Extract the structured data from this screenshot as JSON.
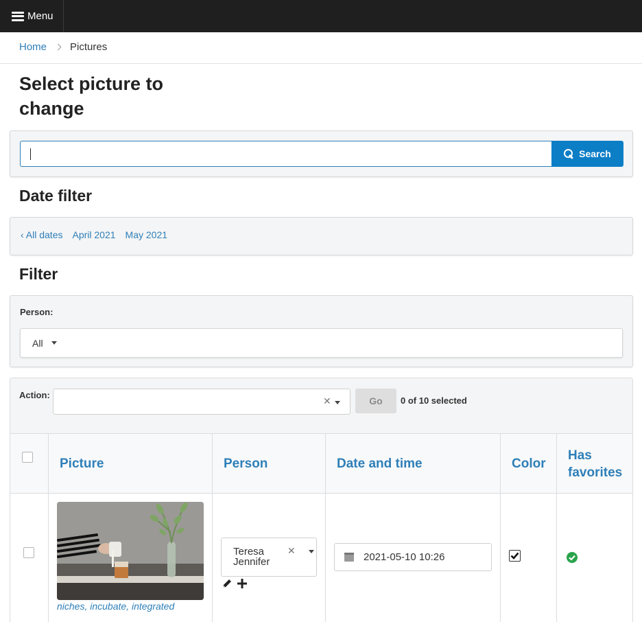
{
  "topbar": {
    "menu_label": "Menu"
  },
  "breadcrumb": {
    "home": "Home",
    "current": "Pictures"
  },
  "page_title": "Select picture to change",
  "search": {
    "value": "",
    "button_label": "Search"
  },
  "date_filter": {
    "heading": "Date filter",
    "links": [
      "‹ All dates",
      "April 2021",
      "May 2021"
    ]
  },
  "filter": {
    "heading": "Filter",
    "person_label": "Person:",
    "person_value": "All"
  },
  "actions": {
    "label": "Action:",
    "value": "",
    "go_label": "Go",
    "selected_text": "0 of 10 selected"
  },
  "table": {
    "columns": [
      "Picture",
      "Person",
      "Date and time",
      "Color",
      "Has favorites"
    ],
    "rows": [
      {
        "checked": false,
        "tags": [
          "niches",
          "incubate",
          "integrated"
        ],
        "person": "Teresa Jennifer",
        "datetime": "2021-05-10 10:26",
        "color": true,
        "has_favorites": true
      }
    ]
  },
  "colors": {
    "accent": "#2e7fb8",
    "topbar": "#1f1f1f",
    "button": "#0c7ec6",
    "success": "#2aa44b"
  },
  "icons": [
    "hamburger-icon",
    "chevron-right-icon",
    "search-icon",
    "dropdown-arrow-icon",
    "clear-icon",
    "calendar-icon",
    "pencil-icon",
    "plus-icon",
    "check-circle-icon"
  ]
}
